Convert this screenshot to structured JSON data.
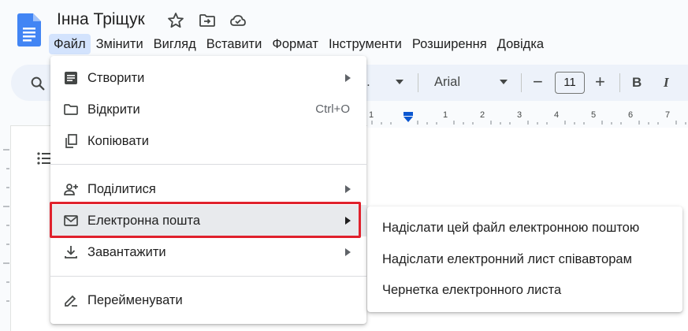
{
  "document": {
    "title": "Інна Тріщук"
  },
  "menubar": {
    "items": [
      {
        "label": "Файл",
        "active": true
      },
      {
        "label": "Змінити"
      },
      {
        "label": "Вигляд"
      },
      {
        "label": "Вставити"
      },
      {
        "label": "Формат"
      },
      {
        "label": "Інструменти"
      },
      {
        "label": "Розширення"
      },
      {
        "label": "Довідка"
      }
    ]
  },
  "toolbar": {
    "style_value": "...",
    "font": "Arial",
    "font_size": "11",
    "minus": "−",
    "plus": "+",
    "bold": "B",
    "italic": "I"
  },
  "ruler": {
    "ticks": [
      "1",
      "1",
      "2",
      "3",
      "4",
      "5",
      "6",
      "7"
    ]
  },
  "file_menu": {
    "items": [
      {
        "label": "Створити",
        "icon": "doc-icon",
        "submenu": true
      },
      {
        "label": "Відкрити",
        "icon": "folder-icon",
        "shortcut": "Ctrl+O"
      },
      {
        "label": "Копіювати",
        "icon": "copy-icon"
      },
      {
        "label": "Поділитися",
        "icon": "person-add-icon",
        "submenu": true
      },
      {
        "label": "Електронна пошта",
        "icon": "mail-icon",
        "submenu": true,
        "highlighted": true
      },
      {
        "label": "Завантажити",
        "icon": "download-icon",
        "submenu": true
      },
      {
        "label": "Перейменувати",
        "icon": "rename-icon"
      }
    ]
  },
  "email_submenu": {
    "items": [
      {
        "label": "Надіслати цей файл електронною поштою"
      },
      {
        "label": "Надіслати електронний лист співавторам"
      },
      {
        "label": "Чернетка електронного листа"
      }
    ]
  },
  "colors": {
    "accent": "#0b57d0",
    "highlight_box": "#e0212c",
    "active_menu": "#d3e3fd"
  }
}
